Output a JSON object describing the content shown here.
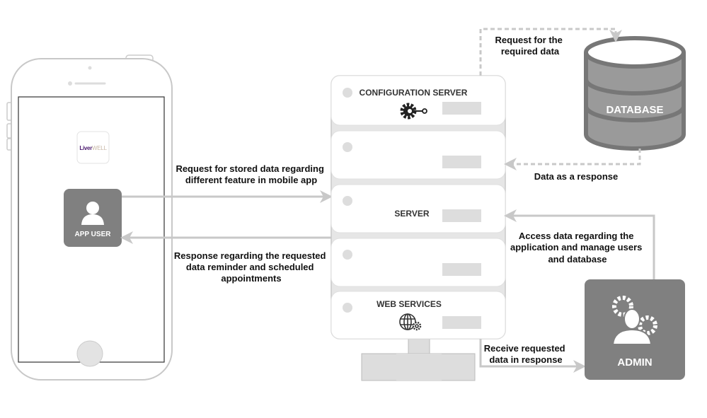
{
  "phone": {
    "app_logo": {
      "part1": "Liver",
      "part2": "WELL"
    },
    "app_user_label": "APP USER"
  },
  "server": {
    "configuration_label": "CONFIGURATION SERVER",
    "server_label": "SERVER",
    "web_services_label": "WEB SERVICES"
  },
  "database": {
    "label": "DATABASE"
  },
  "admin": {
    "label": "ADMIN"
  },
  "arrows": {
    "request_stored": [
      "Request for stored data regarding",
      "different feature in mobile app"
    ],
    "response_requested": [
      "Response regarding the requested",
      "data reminder and scheduled",
      "appointments"
    ],
    "request_required": [
      "Request for the",
      "required data"
    ],
    "data_response": [
      "Data as a response"
    ],
    "access_data": [
      "Access data regarding the",
      "application and manage users",
      "and database"
    ],
    "receive_requested": [
      "Receive requested",
      "data in response"
    ]
  },
  "colors": {
    "box": "#808080",
    "arrow": "#c8c8c8",
    "db_fill": "#9a9a9a",
    "db_stroke": "#777777",
    "logo_purple": "#4b1a6e"
  }
}
